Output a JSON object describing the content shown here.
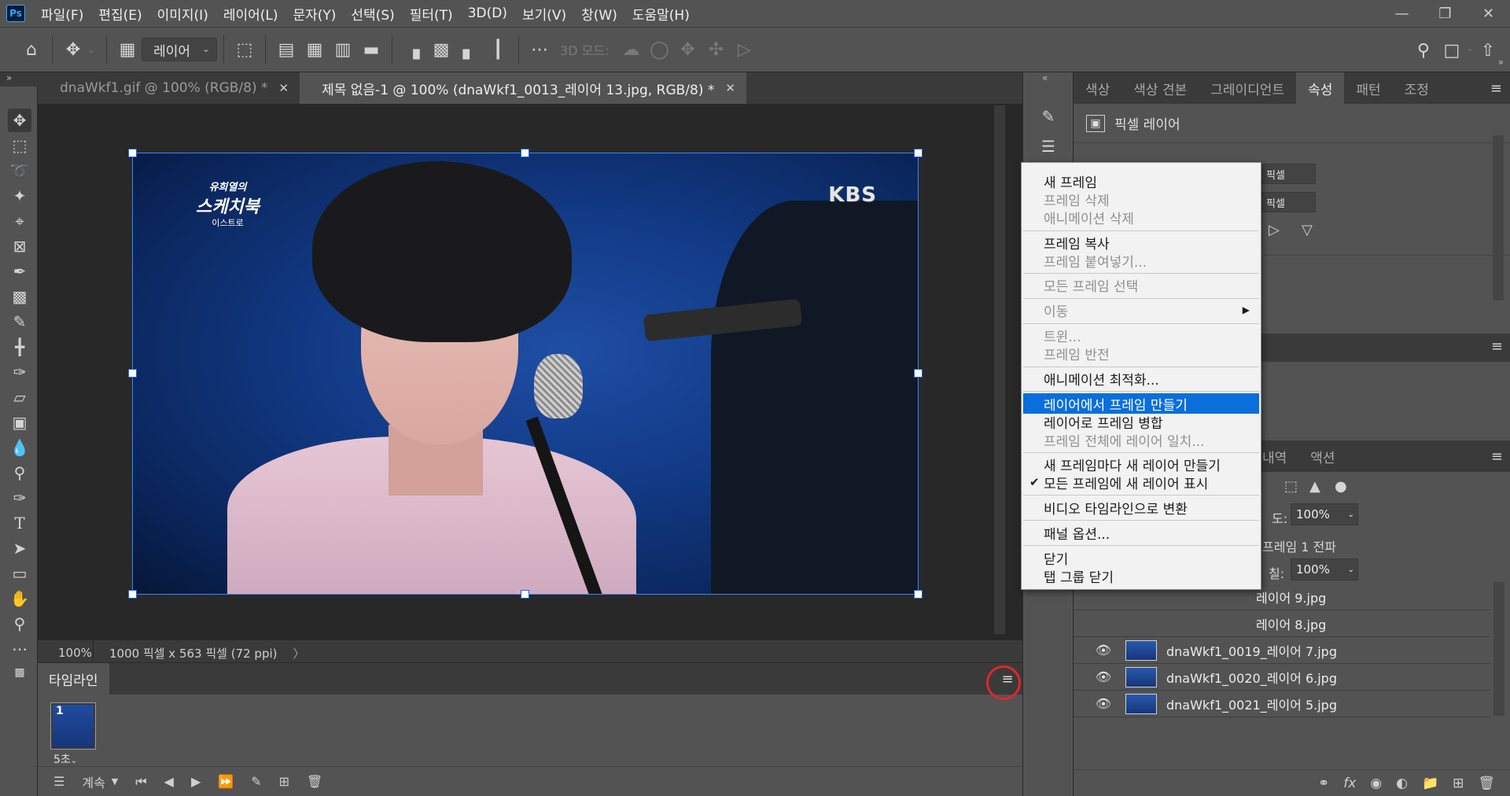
{
  "menubar": {
    "logo": "Ps",
    "items": [
      "파일(F)",
      "편집(E)",
      "이미지(I)",
      "레이어(L)",
      "문자(Y)",
      "선택(S)",
      "필터(T)",
      "3D(D)",
      "보기(V)",
      "창(W)",
      "도움말(H)"
    ]
  },
  "optionsbar": {
    "layer_select": "레이어",
    "mode_3d": "3D 모드:"
  },
  "tabs": [
    {
      "label": "dnaWkf1.gif @ 100% (RGB/8) *"
    },
    {
      "label": "제목 없음-1 @ 100% (dnaWkf1_0013_레이어 13.jpg, RGB/8) *"
    }
  ],
  "canvas": {
    "logo_left_line1": "유희열의",
    "logo_left_line2": "스케치북",
    "logo_left_line3": "이스트로",
    "logo_right": "KBS"
  },
  "status": {
    "zoom": "100%",
    "doc_size": "1000 픽셀 x 563 픽셀 (72 ppi)"
  },
  "timeline": {
    "title": "타임라인",
    "frame_number": "1",
    "frame_delay": "5초",
    "loop": "계속"
  },
  "right_panel": {
    "tabs": [
      "색상",
      "색상 견본",
      "그레이디언트",
      "속성",
      "패턴",
      "조정"
    ],
    "active_tab": "속성",
    "pixel_layer_label": "픽셀 레이어",
    "field_w_unit": "픽셀",
    "field_h_unit": "픽셀",
    "history_tabs": [
      "내역",
      "액션"
    ],
    "opacity_label": "도:",
    "opacity_value": "100%",
    "propagate_label": "프레임 1 전파",
    "fill_label": "칠:",
    "fill_value": "100%",
    "layers": [
      {
        "name": "레이어 9.jpg"
      },
      {
        "name": "레이어 8.jpg"
      },
      {
        "name": "dnaWkf1_0019_레이어 7.jpg"
      },
      {
        "name": "dnaWkf1_0020_레이어 6.jpg"
      },
      {
        "name": "dnaWkf1_0021_레이어 5.jpg"
      }
    ]
  },
  "context_menu": {
    "items": [
      {
        "label": "새 프레임",
        "enabled": true
      },
      {
        "label": "프레임 삭제",
        "enabled": false
      },
      {
        "label": "애니메이션 삭제",
        "enabled": false
      },
      {
        "label": "프레임 복사",
        "enabled": true
      },
      {
        "label": "프레임 붙여넣기...",
        "enabled": false
      },
      {
        "label": "모든 프레임 선택",
        "enabled": false
      },
      {
        "label": "이동",
        "enabled": false
      },
      {
        "label": "트윈...",
        "enabled": false
      },
      {
        "label": "프레임 반전",
        "enabled": false
      },
      {
        "label": "애니메이션 최적화...",
        "enabled": true
      },
      {
        "label": "레이어에서 프레임 만들기",
        "enabled": true,
        "highlighted": true
      },
      {
        "label": "레이어로 프레임 병합",
        "enabled": true
      },
      {
        "label": "프레임 전체에 레이어 일치...",
        "enabled": false
      },
      {
        "label": "새 프레임마다 새 레이어 만들기",
        "enabled": true
      },
      {
        "label": "모든 프레임에 새 레이어 표시",
        "enabled": true,
        "checked": true
      },
      {
        "label": "비디오 타임라인으로 변환",
        "enabled": true
      },
      {
        "label": "패널 옵션...",
        "enabled": true
      },
      {
        "label": "닫기",
        "enabled": true
      },
      {
        "label": "탭 그룹 닫기",
        "enabled": true
      }
    ]
  },
  "colors": {
    "highlight": "#0a6edb",
    "selection": "#3a86ff",
    "annotation_ring": "#e0262c"
  }
}
